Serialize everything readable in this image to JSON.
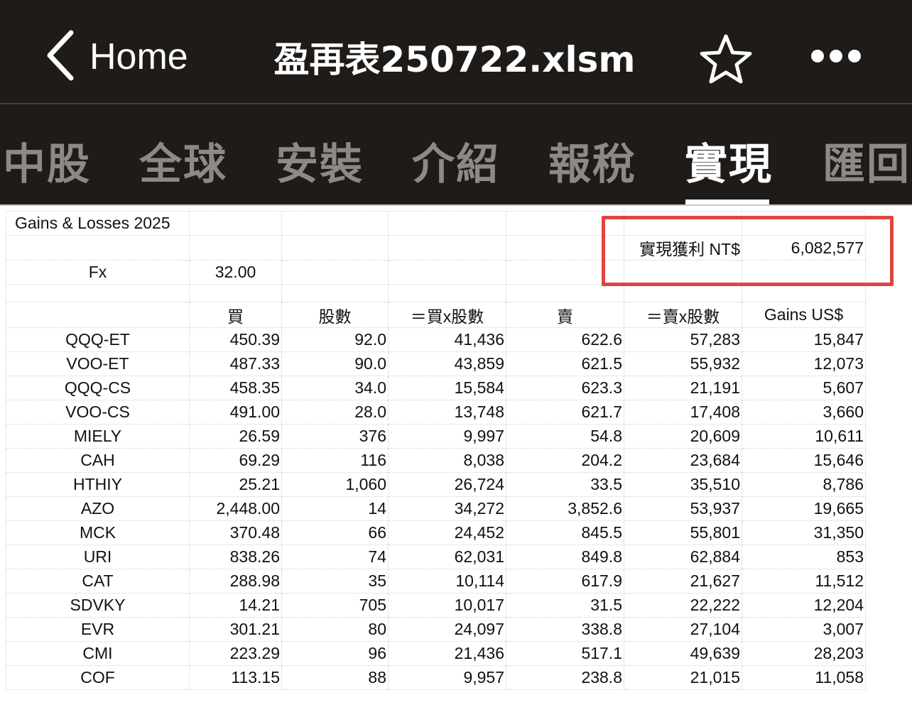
{
  "app": {
    "back_label": "Home",
    "doc_title": "盈再表250722.xlsm",
    "icons": {
      "back": "chevron-left-icon",
      "star": "star-icon",
      "more": "more-horizontal-icon"
    }
  },
  "tabs": [
    {
      "label": "中股",
      "active": false
    },
    {
      "label": "全球",
      "active": false
    },
    {
      "label": "安裝",
      "active": false
    },
    {
      "label": "介紹",
      "active": false
    },
    {
      "label": "報稅",
      "active": false
    },
    {
      "label": "實現",
      "active": true
    },
    {
      "label": "匯回",
      "active": false
    }
  ],
  "sheet": {
    "title": "Gains & Losses 2025",
    "realized_label": "實現獲利 NT$",
    "realized_value": "6,082,577",
    "fx_label": "Fx",
    "fx_value": "32.00",
    "headers": [
      "買",
      "股數",
      "＝買x股數",
      "賣",
      "＝賣x股數",
      "Gains US$"
    ],
    "rows": [
      {
        "ticker": "QQQ-ET",
        "buy": "450.39",
        "shares": "92.0",
        "cost": "41,436",
        "sell": "622.6",
        "proceeds": "57,283",
        "gain": "15,847"
      },
      {
        "ticker": "VOO-ET",
        "buy": "487.33",
        "shares": "90.0",
        "cost": "43,859",
        "sell": "621.5",
        "proceeds": "55,932",
        "gain": "12,073"
      },
      {
        "ticker": "QQQ-CS",
        "buy": "458.35",
        "shares": "34.0",
        "cost": "15,584",
        "sell": "623.3",
        "proceeds": "21,191",
        "gain": "5,607"
      },
      {
        "ticker": "VOO-CS",
        "buy": "491.00",
        "shares": "28.0",
        "cost": "13,748",
        "sell": "621.7",
        "proceeds": "17,408",
        "gain": "3,660"
      },
      {
        "ticker": "MIELY",
        "buy": "26.59",
        "shares": "376",
        "cost": "9,997",
        "sell": "54.8",
        "proceeds": "20,609",
        "gain": "10,611"
      },
      {
        "ticker": "CAH",
        "buy": "69.29",
        "shares": "116",
        "cost": "8,038",
        "sell": "204.2",
        "proceeds": "23,684",
        "gain": "15,646"
      },
      {
        "ticker": "HTHIY",
        "buy": "25.21",
        "shares": "1,060",
        "cost": "26,724",
        "sell": "33.5",
        "proceeds": "35,510",
        "gain": "8,786"
      },
      {
        "ticker": "AZO",
        "buy": "2,448.00",
        "shares": "14",
        "cost": "34,272",
        "sell": "3,852.6",
        "proceeds": "53,937",
        "gain": "19,665"
      },
      {
        "ticker": "MCK",
        "buy": "370.48",
        "shares": "66",
        "cost": "24,452",
        "sell": "845.5",
        "proceeds": "55,801",
        "gain": "31,350"
      },
      {
        "ticker": "URI",
        "buy": "838.26",
        "shares": "74",
        "cost": "62,031",
        "sell": "849.8",
        "proceeds": "62,884",
        "gain": "853"
      },
      {
        "ticker": "CAT",
        "buy": "288.98",
        "shares": "35",
        "cost": "10,114",
        "sell": "617.9",
        "proceeds": "21,627",
        "gain": "11,512"
      },
      {
        "ticker": "SDVKY",
        "buy": "14.21",
        "shares": "705",
        "cost": "10,017",
        "sell": "31.5",
        "proceeds": "22,222",
        "gain": "12,204"
      },
      {
        "ticker": "EVR",
        "buy": "301.21",
        "shares": "80",
        "cost": "24,097",
        "sell": "338.8",
        "proceeds": "27,104",
        "gain": "3,007"
      },
      {
        "ticker": "CMI",
        "buy": "223.29",
        "shares": "96",
        "cost": "21,436",
        "sell": "517.1",
        "proceeds": "49,639",
        "gain": "28,203"
      },
      {
        "ticker": "COF",
        "buy": "113.15",
        "shares": "88",
        "cost": "9,957",
        "sell": "238.8",
        "proceeds": "21,015",
        "gain": "11,058"
      }
    ]
  },
  "colors": {
    "topbar_bg": "#1e1b18",
    "tab_inactive": "#8f8985",
    "tab_active": "#ffffff",
    "highlight_border": "#e0453f"
  }
}
